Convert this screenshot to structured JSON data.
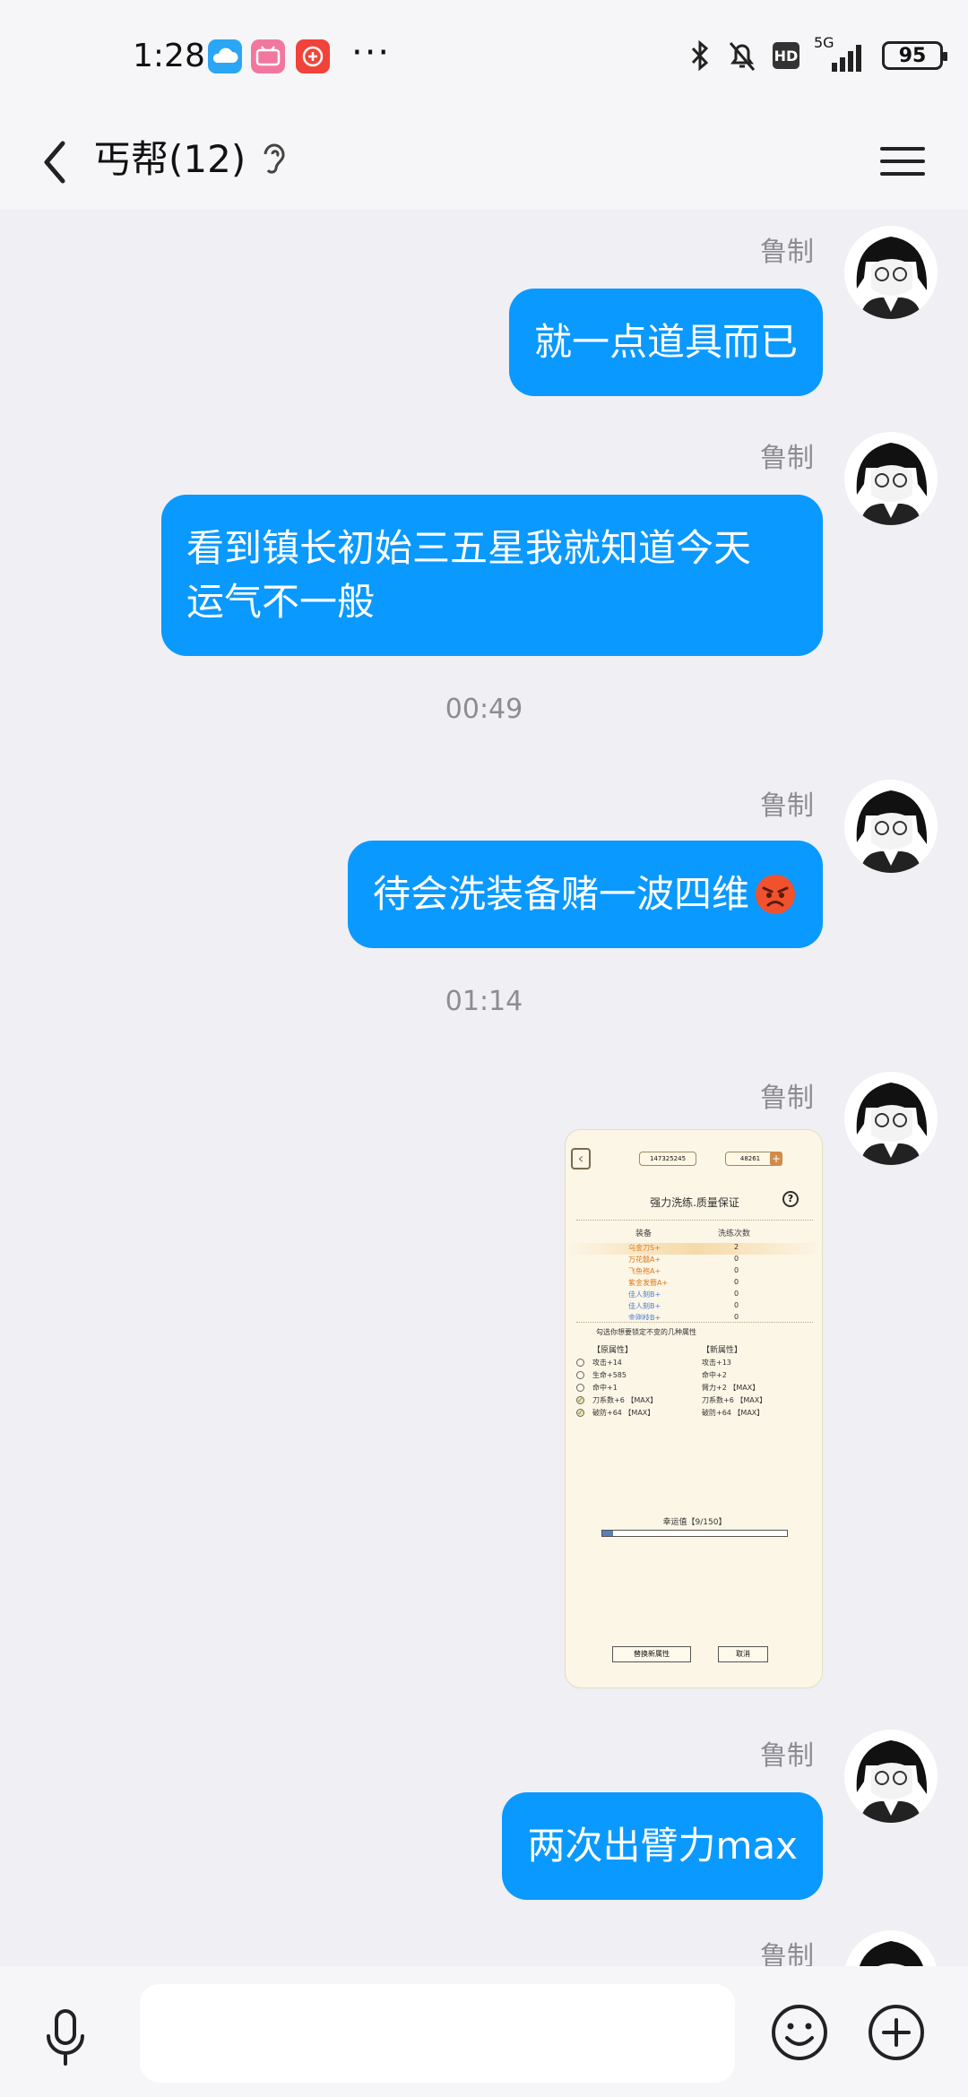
{
  "status_bar": {
    "time": "1:28",
    "apps": [
      "cloud-app-icon",
      "bilibili-app-icon",
      "taobao-app-icon"
    ],
    "more": "···",
    "hd": "HD",
    "net": "5G",
    "battery": "95"
  },
  "header": {
    "title": "丐帮(12)"
  },
  "messages": [
    {
      "sender": "鲁制",
      "text": "就一点道具而已"
    },
    {
      "sender": "鲁制",
      "line1": "看到镇长初始三五星我就知道今天",
      "line2": "运气不一般"
    },
    {
      "timestamp": "00:49"
    },
    {
      "sender": "鲁制",
      "text": "待会洗装备赌一波四维",
      "emoji": "angry-face-emoji"
    },
    {
      "timestamp": "01:14"
    },
    {
      "sender": "鲁制",
      "image": {
        "top_left_value": "147325245",
        "top_right_value": "48261",
        "title": "强力洗练.质量保证",
        "col_equip": "装备",
        "col_count": "洗练次数",
        "rows": [
          {
            "name": "乌金刀S+",
            "count": "2",
            "color": "#e07a1c"
          },
          {
            "name": "万花髓A+",
            "count": "0",
            "color": "#e07a1c"
          },
          {
            "name": "飞鱼袍A+",
            "count": "0",
            "color": "#e07a1c"
          },
          {
            "name": "紫金发簪A+",
            "count": "0",
            "color": "#e07a1c"
          },
          {
            "name": "佳人刻B+",
            "count": "0",
            "color": "#4a7ed6"
          },
          {
            "name": "佳人刻B+",
            "count": "0",
            "color": "#4a7ed6"
          },
          {
            "name": "金刚枝B+",
            "count": "0",
            "color": "#4a7ed6"
          }
        ],
        "hint": "勾选你想要锁定不变的几种属性",
        "col_old": "【原属性】",
        "col_new": "【新属性】",
        "attrs": [
          {
            "old": "攻击+14",
            "new": "攻击+13",
            "checked": false
          },
          {
            "old": "生命+585",
            "new": "命中+2",
            "checked": false
          },
          {
            "old": "命中+1",
            "new": "臂力+2 【MAX】",
            "checked": false
          },
          {
            "old": "刀系数+6 【MAX】",
            "new": "刀系数+6 【MAX】",
            "checked": true
          },
          {
            "old": "破防+64 【MAX】",
            "new": "破防+64 【MAX】",
            "checked": true
          }
        ],
        "luck_label": "幸运值【9/150】",
        "luck_fraction": 0.06,
        "btn_replace": "替换新属性",
        "btn_cancel": "取消"
      }
    },
    {
      "sender": "鲁制",
      "text": "两次出臂力max"
    },
    {
      "sender": "鲁制"
    }
  ],
  "input": {
    "placeholder": ""
  }
}
